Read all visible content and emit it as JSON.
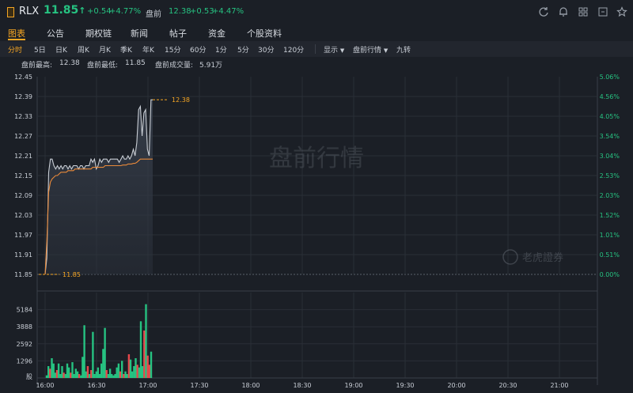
{
  "header": {
    "symbol": "RLX",
    "price": "11.85",
    "price_arrow": "↑",
    "change": "+0.54",
    "change_pct": "+4.77%",
    "premarket_label": "盘前",
    "premarket_price": "12.38",
    "premarket_change": "+0.53",
    "premarket_change_pct": "+4.47%",
    "icons": [
      "refresh-icon",
      "bell-icon",
      "grid-icon",
      "settings-icon",
      "star-icon"
    ]
  },
  "tabs": [
    {
      "label": "图表",
      "active": true
    },
    {
      "label": "公告",
      "active": false
    },
    {
      "label": "期权链",
      "active": false
    },
    {
      "label": "新闻",
      "active": false
    },
    {
      "label": "帖子",
      "active": false
    },
    {
      "label": "资金",
      "active": false
    },
    {
      "label": "个股资料",
      "active": false
    }
  ],
  "toolbar": {
    "intervals": [
      {
        "label": "分时",
        "active": true
      },
      {
        "label": "5日",
        "active": false
      },
      {
        "label": "日K",
        "active": false
      },
      {
        "label": "周K",
        "active": false
      },
      {
        "label": "月K",
        "active": false
      },
      {
        "label": "季K",
        "active": false
      },
      {
        "label": "年K",
        "active": false
      },
      {
        "label": "15分",
        "active": false
      },
      {
        "label": "60分",
        "active": false
      },
      {
        "label": "1分",
        "active": false
      },
      {
        "label": "5分",
        "active": false
      },
      {
        "label": "30分",
        "active": false
      },
      {
        "label": "120分",
        "active": false
      }
    ],
    "display_label": "显示",
    "premarket_dropdown": "盘前行情",
    "nine_turn": "九转"
  },
  "stats": {
    "high_label": "盘前最高:",
    "high_value": "12.38",
    "low_label": "盘前最低:",
    "low_value": "11.85",
    "volume_label": "盘前成交量:",
    "volume_value": "5.91万"
  },
  "colors": {
    "up": "#26c281",
    "down": "#e8474b",
    "accent": "#f6a623",
    "avg_line": "#e8893a",
    "price_line": "#c8cdd4",
    "bg": "#1b1f26"
  },
  "chart_data": {
    "type": "line",
    "title": "",
    "watermark": "盘前行情",
    "brand": "老虎證券",
    "x_ticks": [
      "16:00",
      "16:30",
      "17:00",
      "17:30",
      "18:00",
      "18:30",
      "19:00",
      "19:30",
      "20:00",
      "20:30",
      "21:00"
    ],
    "y_ticks_left": [
      "12.45",
      "12.39",
      "12.33",
      "12.27",
      "12.21",
      "12.15",
      "12.09",
      "12.03",
      "11.97",
      "11.91",
      "11.85"
    ],
    "y_ticks_right": [
      "5.06%",
      "4.56%",
      "4.05%",
      "3.54%",
      "3.04%",
      "2.53%",
      "2.03%",
      "1.52%",
      "1.01%",
      "0.51%",
      "0.00%"
    ],
    "ylim": [
      11.85,
      12.45
    ],
    "price_high_label": "12.38",
    "price_low_label": "11.85",
    "series": [
      {
        "values": [
          11.85,
          11.9,
          12.16,
          12.2,
          12.2,
          12.18,
          12.17,
          12.18,
          12.17,
          12.18,
          12.17,
          12.18,
          12.18,
          12.17,
          12.18,
          12.17,
          12.18,
          12.18,
          12.18,
          12.17,
          12.18,
          12.18,
          12.17,
          12.18,
          12.18,
          12.18,
          12.2,
          12.19,
          12.2,
          12.17,
          12.18,
          12.2,
          12.19,
          12.2,
          12.2,
          12.2,
          12.19,
          12.2,
          12.2,
          12.2,
          12.2,
          12.2,
          12.19,
          12.2,
          12.21,
          12.2,
          12.2,
          12.21,
          12.2,
          12.21,
          12.23,
          12.21,
          12.25,
          12.35,
          12.36,
          12.27,
          12.34,
          12.35,
          12.23,
          12.21,
          12.38,
          12.38
        ]
      },
      {
        "values": [
          11.85,
          11.95,
          12.1,
          12.13,
          12.14,
          12.145,
          12.15,
          12.15,
          12.155,
          12.16,
          12.16,
          12.16,
          12.16,
          12.165,
          12.165,
          12.165,
          12.165,
          12.17,
          12.17,
          12.17,
          12.17,
          12.17,
          12.17,
          12.17,
          12.17,
          12.17,
          12.17,
          12.175,
          12.175,
          12.175,
          12.175,
          12.175,
          12.175,
          12.175,
          12.18,
          12.18,
          12.18,
          12.18,
          12.18,
          12.18,
          12.18,
          12.18,
          12.18,
          12.18,
          12.182,
          12.182,
          12.182,
          12.185,
          12.185,
          12.185,
          12.187,
          12.187,
          12.19,
          12.195,
          12.2,
          12.2,
          12.2,
          12.2,
          12.2,
          12.2,
          12.2,
          12.2
        ]
      }
    ],
    "volume_ticks": [
      "5184",
      "3888",
      "2592",
      "1296",
      "股"
    ],
    "volume_max": 6000,
    "volume": [
      {
        "v": 200,
        "up": true
      },
      {
        "v": 900,
        "up": true
      },
      {
        "v": 700,
        "up": false
      },
      {
        "v": 1500,
        "up": true
      },
      {
        "v": 1100,
        "up": true
      },
      {
        "v": 400,
        "up": true
      },
      {
        "v": 600,
        "up": false
      },
      {
        "v": 1100,
        "up": true
      },
      {
        "v": 300,
        "up": true
      },
      {
        "v": 900,
        "up": true
      },
      {
        "v": 400,
        "up": false
      },
      {
        "v": 300,
        "up": true
      },
      {
        "v": 1100,
        "up": true
      },
      {
        "v": 800,
        "up": true
      },
      {
        "v": 400,
        "up": false
      },
      {
        "v": 1200,
        "up": true
      },
      {
        "v": 300,
        "up": true
      },
      {
        "v": 700,
        "up": true
      },
      {
        "v": 500,
        "up": true
      },
      {
        "v": 300,
        "up": false
      },
      {
        "v": 200,
        "up": true
      },
      {
        "v": 1600,
        "up": true
      },
      {
        "v": 4000,
        "up": true
      },
      {
        "v": 500,
        "up": true
      },
      {
        "v": 900,
        "up": false
      },
      {
        "v": 300,
        "up": true
      },
      {
        "v": 600,
        "up": false
      },
      {
        "v": 3500,
        "up": true
      },
      {
        "v": 300,
        "up": true
      },
      {
        "v": 500,
        "up": true
      },
      {
        "v": 800,
        "up": true
      },
      {
        "v": 300,
        "up": true
      },
      {
        "v": 1100,
        "up": true
      },
      {
        "v": 2200,
        "up": true
      },
      {
        "v": 3800,
        "up": true
      },
      {
        "v": 600,
        "up": false
      },
      {
        "v": 300,
        "up": true
      },
      {
        "v": 700,
        "up": true
      },
      {
        "v": 300,
        "up": true
      },
      {
        "v": 200,
        "up": true
      },
      {
        "v": 300,
        "up": true
      },
      {
        "v": 800,
        "up": true
      },
      {
        "v": 1100,
        "up": true
      },
      {
        "v": 500,
        "up": false
      },
      {
        "v": 1300,
        "up": true
      },
      {
        "v": 300,
        "up": false
      },
      {
        "v": 500,
        "up": true
      },
      {
        "v": 300,
        "up": true
      },
      {
        "v": 1800,
        "up": false
      },
      {
        "v": 1400,
        "up": true
      },
      {
        "v": 500,
        "up": true
      },
      {
        "v": 900,
        "up": true
      },
      {
        "v": 1500,
        "up": true
      },
      {
        "v": 1000,
        "up": false
      },
      {
        "v": 800,
        "up": true
      },
      {
        "v": 4300,
        "up": true
      },
      {
        "v": 900,
        "up": true
      },
      {
        "v": 3600,
        "up": false
      },
      {
        "v": 5600,
        "up": true
      },
      {
        "v": 1700,
        "up": false
      },
      {
        "v": 1000,
        "up": false
      },
      {
        "v": 2000,
        "up": true
      }
    ]
  }
}
